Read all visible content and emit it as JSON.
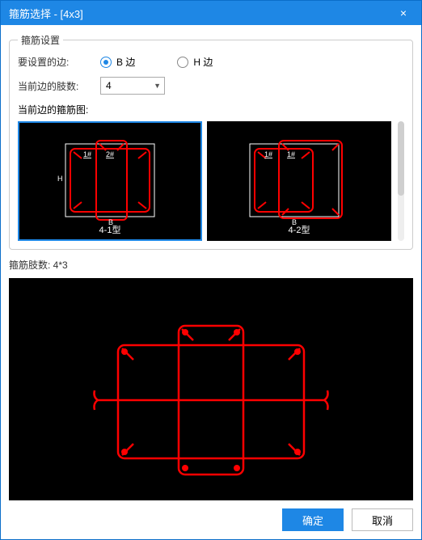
{
  "window": {
    "title": "箍筋选择 - [4x3]",
    "close_glyph": "×"
  },
  "group": {
    "legend": "箍筋设置"
  },
  "edge_row": {
    "label": "要设置的边:",
    "option_b": "B 边",
    "option_h": "H 边",
    "selected": "B"
  },
  "count_row": {
    "label": "当前边的肢数:",
    "value": "4"
  },
  "diagram_row": {
    "label": "当前边的箍筋图:"
  },
  "thumbs": [
    {
      "caption": "4-1型",
      "labels": {
        "one": "1#",
        "two": "2#",
        "h": "H",
        "b": "B"
      },
      "selected": true
    },
    {
      "caption": "4-2型",
      "labels": {
        "one": "1#",
        "two": "1#",
        "h": "",
        "b": "B"
      },
      "selected": false
    }
  ],
  "summary": {
    "label": "箍筋肢数: 4*3"
  },
  "buttons": {
    "ok": "确定",
    "cancel": "取消"
  }
}
